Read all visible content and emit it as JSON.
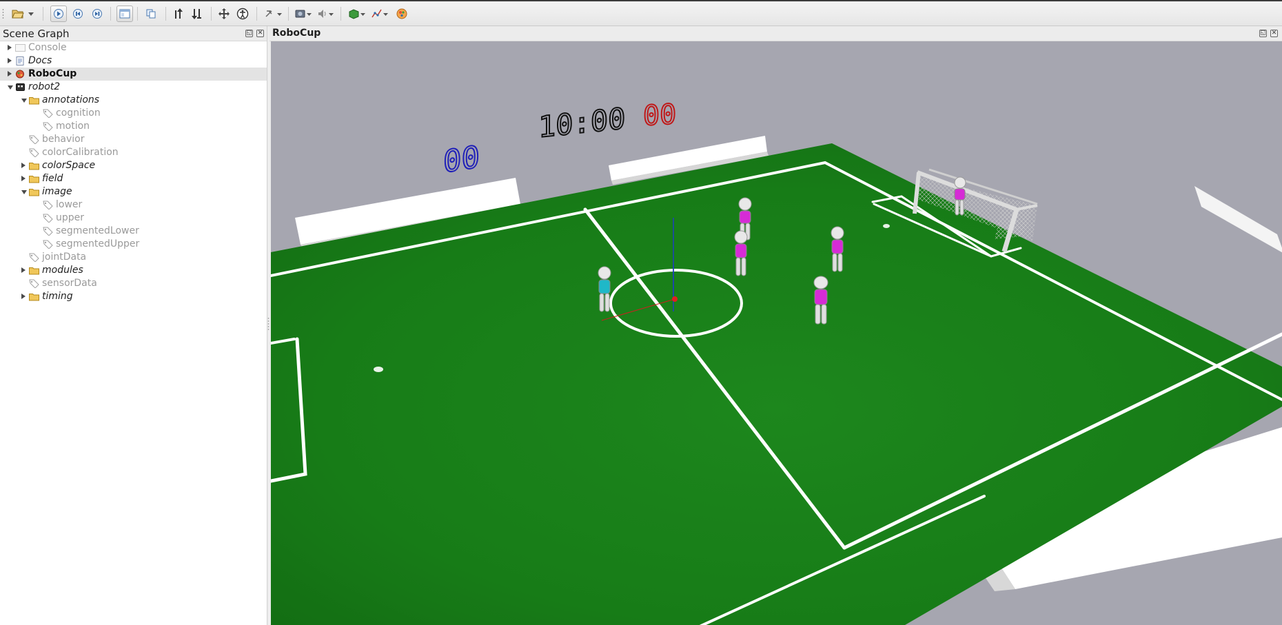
{
  "toolbar": {
    "buttons": [
      {
        "name": "open-icon"
      },
      {
        "name": "dropdown-icon"
      },
      {
        "name": "play-icon",
        "active": true
      },
      {
        "name": "step-back-icon"
      },
      {
        "name": "step-icon"
      },
      {
        "name": "layout-icon",
        "active": true
      },
      {
        "name": "copy-icon"
      },
      {
        "name": "move-up-icon"
      },
      {
        "name": "move-down-icon"
      },
      {
        "name": "drag-icon"
      },
      {
        "name": "accessibility-icon"
      },
      {
        "name": "tools-icon"
      },
      {
        "name": "camera-icon"
      },
      {
        "name": "sound-icon"
      },
      {
        "name": "render-mode-icon"
      },
      {
        "name": "graph-icon"
      },
      {
        "name": "color-icon"
      }
    ]
  },
  "scene_graph": {
    "title": "Scene Graph",
    "items": [
      {
        "label": "Console",
        "style": "gray",
        "depth": 0,
        "arrow": "right",
        "icon": "console"
      },
      {
        "label": "Docs",
        "style": "italic",
        "depth": 0,
        "arrow": "right",
        "icon": "doc"
      },
      {
        "label": "RoboCup",
        "style": "bold",
        "depth": 0,
        "arrow": "right",
        "icon": "robocup",
        "selected": true
      },
      {
        "label": "robot2",
        "style": "italic",
        "depth": 0,
        "arrow": "down",
        "icon": "robot"
      },
      {
        "label": "annotations",
        "style": "italic",
        "depth": 1,
        "arrow": "down",
        "icon": "folder"
      },
      {
        "label": "cognition",
        "style": "gray",
        "depth": 2,
        "arrow": "",
        "icon": "tag"
      },
      {
        "label": "motion",
        "style": "gray",
        "depth": 2,
        "arrow": "",
        "icon": "tag"
      },
      {
        "label": "behavior",
        "style": "gray",
        "depth": 1,
        "arrow": "",
        "icon": "tag"
      },
      {
        "label": "colorCalibration",
        "style": "gray",
        "depth": 1,
        "arrow": "",
        "icon": "tag"
      },
      {
        "label": "colorSpace",
        "style": "italic",
        "depth": 1,
        "arrow": "right",
        "icon": "folder"
      },
      {
        "label": "field",
        "style": "italic",
        "depth": 1,
        "arrow": "right",
        "icon": "folder"
      },
      {
        "label": "image",
        "style": "italic",
        "depth": 1,
        "arrow": "down",
        "icon": "folder"
      },
      {
        "label": "lower",
        "style": "gray",
        "depth": 2,
        "arrow": "",
        "icon": "tag"
      },
      {
        "label": "upper",
        "style": "gray",
        "depth": 2,
        "arrow": "",
        "icon": "tag"
      },
      {
        "label": "segmentedLower",
        "style": "gray",
        "depth": 2,
        "arrow": "",
        "icon": "tag"
      },
      {
        "label": "segmentedUpper",
        "style": "gray",
        "depth": 2,
        "arrow": "",
        "icon": "tag"
      },
      {
        "label": "jointData",
        "style": "gray",
        "depth": 1,
        "arrow": "",
        "icon": "tag"
      },
      {
        "label": "modules",
        "style": "italic",
        "depth": 1,
        "arrow": "right",
        "icon": "folder"
      },
      {
        "label": "sensorData",
        "style": "gray",
        "depth": 1,
        "arrow": "",
        "icon": "tag"
      },
      {
        "label": "timing",
        "style": "italic",
        "depth": 1,
        "arrow": "right",
        "icon": "folder"
      }
    ]
  },
  "view": {
    "title": "RoboCup",
    "clock": "10:00",
    "score_blue": "00",
    "score_red": "00",
    "colors": {
      "sky": "#a6a6b0",
      "field": "#1e8a1e",
      "lines": "#ffffff",
      "team_blue": "#1f1fb8",
      "team_red": "#c01818",
      "jersey_magenta": "#d62bd6",
      "jersey_cyan": "#1fb8c8"
    }
  }
}
